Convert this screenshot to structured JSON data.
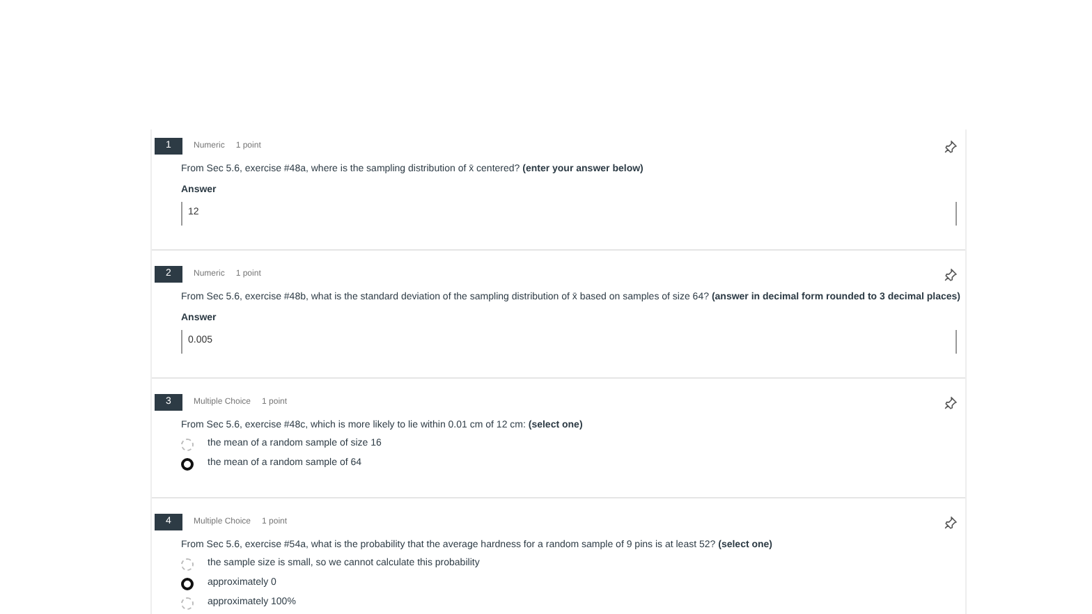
{
  "questions": [
    {
      "number": "1",
      "type": "Numeric",
      "points": "1 point",
      "kind": "numeric",
      "text": "From Sec 5.6, exercise #48a, where is the sampling distribution of x̄ centered?  **(enter your answer below)**",
      "answer_label": "Answer",
      "value": "12"
    },
    {
      "number": "2",
      "type": "Numeric",
      "points": "1 point",
      "kind": "numeric",
      "text": "From Sec 5.6, exercise #48b, what is the standard deviation of the sampling distribution of x̄ based on samples of size 64?  **(answer in decimal form rounded to 3 decimal places)**",
      "answer_label": "Answer",
      "value": "0.005"
    },
    {
      "number": "3",
      "type": "Multiple Choice",
      "points": "1 point",
      "kind": "choice",
      "text": "From Sec 5.6, exercise #48c, which is more likely to lie within 0.01 cm of 12 cm: **(select one)**",
      "options": [
        {
          "label": "the mean of a random sample of size 16",
          "selected": false
        },
        {
          "label": "the mean of a random sample of 64",
          "selected": true
        }
      ]
    },
    {
      "number": "4",
      "type": "Multiple Choice",
      "points": "1 point",
      "kind": "choice",
      "text": "From Sec 5.6, exercise #54a, what is the probability that the average hardness for a random sample of 9 pins is at least 52?  **(select one)**",
      "options": [
        {
          "label": "the sample size is small, so we cannot calculate this probability",
          "selected": false
        },
        {
          "label": "approximately 0",
          "selected": true
        },
        {
          "label": "approximately 100%",
          "selected": false
        }
      ]
    }
  ]
}
